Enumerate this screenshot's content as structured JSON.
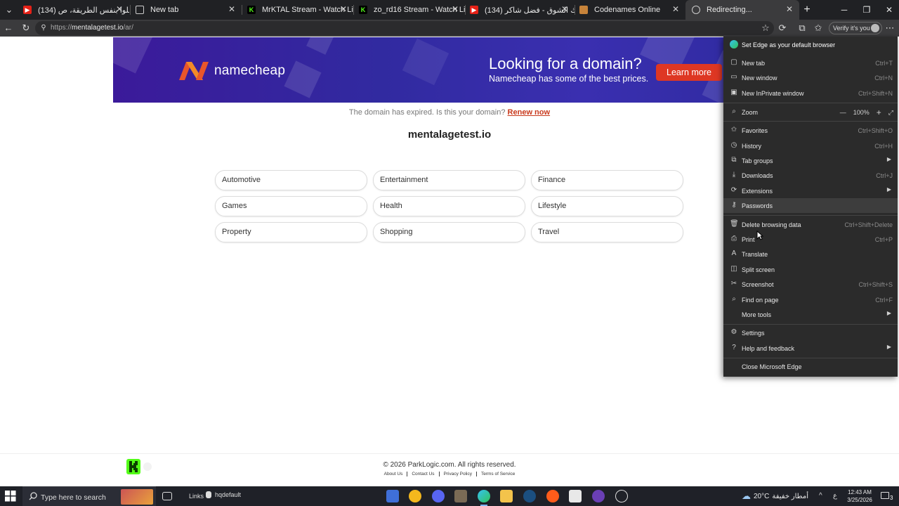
{
  "browser": {
    "tabs": [
      {
        "title": "(134) اربعة رحلوا بنفس الطريقة، ص",
        "favicon": "youtube-icon"
      },
      {
        "title": "New tab",
        "favicon": "newtab-icon"
      },
      {
        "title": "MrKTAL Stream - Watch Live on Ki",
        "favicon": "kick-icon"
      },
      {
        "title": "zo_rd16 Stream - Watch Live on Ki",
        "favicon": "kick-icon"
      },
      {
        "title": "(134) ضحاك الشوق - فضل شاكر - a",
        "favicon": "youtube-icon"
      },
      {
        "title": "Codenames Online",
        "favicon": "codenames-icon"
      },
      {
        "title": "Redirecting...",
        "favicon": "globe-icon"
      }
    ],
    "url_scheme": "https://",
    "url_host": "mentalagetest.io",
    "url_path": "/ar/",
    "verify_label": "Verify it's you"
  },
  "page": {
    "banner": {
      "brand": "namecheap",
      "headline": "Looking for a domain?",
      "subline": "Namecheap has some of the best prices.",
      "cta": "Learn more"
    },
    "expired_text": "The domain has expired. Is this your domain?",
    "renew_link": "Renew now",
    "domain": "mentalagetest.io",
    "categories": [
      "Automotive",
      "Entertainment",
      "Finance",
      "Games",
      "Health",
      "Lifestyle",
      "Property",
      "Shopping",
      "Travel"
    ],
    "copyright": "© 2026 ParkLogic.com. All rights reserved.",
    "footer_links": [
      "About Us",
      "Contact Us",
      "Privacy Policy",
      "Terms of Service"
    ]
  },
  "menu": {
    "default_browser": "Set Edge as your default browser",
    "items": [
      {
        "label": "New tab",
        "shortcut": "Ctrl+T",
        "icon": "new-tab-icon"
      },
      {
        "label": "New window",
        "shortcut": "Ctrl+N",
        "icon": "new-window-icon"
      },
      {
        "label": "New InPrivate window",
        "shortcut": "Ctrl+Shift+N",
        "icon": "inprivate-icon"
      },
      {
        "label": "Zoom",
        "shortcut": "",
        "icon": "zoom-icon"
      },
      {
        "label": "Favorites",
        "shortcut": "Ctrl+Shift+O",
        "icon": "favorites-icon"
      },
      {
        "label": "History",
        "shortcut": "Ctrl+H",
        "icon": "history-icon"
      },
      {
        "label": "Tab groups",
        "shortcut": "",
        "icon": "tab-groups-icon"
      },
      {
        "label": "Downloads",
        "shortcut": "Ctrl+J",
        "icon": "downloads-icon"
      },
      {
        "label": "Extensions",
        "shortcut": "",
        "icon": "extensions-icon"
      },
      {
        "label": "Passwords",
        "shortcut": "",
        "icon": "passwords-icon"
      },
      {
        "label": "Delete browsing data",
        "shortcut": "Ctrl+Shift+Delete",
        "icon": "delete-data-icon"
      },
      {
        "label": "Print",
        "shortcut": "Ctrl+P",
        "icon": "print-icon"
      },
      {
        "label": "Translate",
        "shortcut": "",
        "icon": "translate-icon"
      },
      {
        "label": "Split screen",
        "shortcut": "",
        "icon": "split-screen-icon"
      },
      {
        "label": "Screenshot",
        "shortcut": "Ctrl+Shift+S",
        "icon": "screenshot-icon"
      },
      {
        "label": "Find on page",
        "shortcut": "Ctrl+F",
        "icon": "find-icon"
      },
      {
        "label": "More tools",
        "shortcut": "",
        "icon": ""
      },
      {
        "label": "Settings",
        "shortcut": "",
        "icon": "settings-icon"
      },
      {
        "label": "Help and feedback",
        "shortcut": "",
        "icon": "help-icon"
      },
      {
        "label": "Close Microsoft Edge",
        "shortcut": "",
        "icon": ""
      }
    ],
    "zoom_value": "100%"
  },
  "taskbar": {
    "search_placeholder": "Type here to search",
    "links_label": "Links",
    "hq_label": "hqdefault",
    "weather_temp": "20°C",
    "weather_text": "أمطار خفيفة",
    "time": "12:43 AM",
    "date": "3/25/2026",
    "notification_count": "3",
    "lang": "ع"
  },
  "colors": {
    "accent_red": "#de3723",
    "banner_bg": "#3b1a9a",
    "menu_bg": "#2b2b2b",
    "kick_green": "#53fc18"
  }
}
